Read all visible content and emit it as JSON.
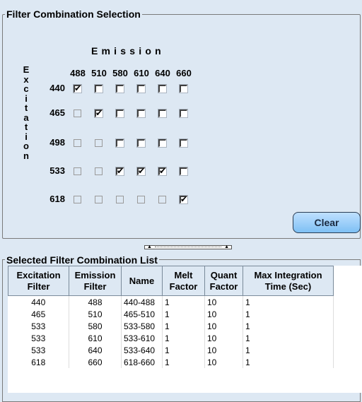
{
  "filter_selection": {
    "title": "Filter Combination Selection",
    "emission_title": "Emission",
    "excitation_title": "Excitation",
    "emission_labels": [
      "488",
      "510",
      "580",
      "610",
      "640",
      "660"
    ],
    "rows": [
      {
        "excitation": "440",
        "cells": [
          "checked",
          "unchecked",
          "unchecked",
          "unchecked",
          "unchecked",
          "unchecked"
        ]
      },
      {
        "excitation": "465",
        "cells": [
          "disabled",
          "checked",
          "unchecked",
          "unchecked",
          "unchecked",
          "unchecked"
        ]
      },
      {
        "excitation": "498",
        "cells": [
          "disabled",
          "disabled",
          "unchecked",
          "unchecked",
          "unchecked",
          "unchecked"
        ]
      },
      {
        "excitation": "533",
        "cells": [
          "disabled",
          "disabled",
          "checked",
          "checked",
          "checked",
          "unchecked"
        ]
      },
      {
        "excitation": "618",
        "cells": [
          "disabled",
          "disabled",
          "disabled",
          "disabled",
          "disabled",
          "checked"
        ]
      }
    ],
    "clear_label": "Clear"
  },
  "combination_list": {
    "title": "Selected Filter Combination List",
    "headers": {
      "excitation": "Excitation Filter",
      "emission": "Emission Filter",
      "name": "Name",
      "melt": "Melt Factor",
      "quant": "Quant Factor",
      "max_integration": "Max Integration Time (Sec)"
    },
    "rows": [
      {
        "excitation": "440",
        "emission": "488",
        "name": "440-488",
        "melt": "1",
        "quant": "10",
        "max": "1"
      },
      {
        "excitation": "465",
        "emission": "510",
        "name": "465-510",
        "melt": "1",
        "quant": "10",
        "max": "1"
      },
      {
        "excitation": "533",
        "emission": "580",
        "name": "533-580",
        "melt": "1",
        "quant": "10",
        "max": "1"
      },
      {
        "excitation": "533",
        "emission": "610",
        "name": "533-610",
        "melt": "1",
        "quant": "10",
        "max": "1"
      },
      {
        "excitation": "533",
        "emission": "640",
        "name": "533-640",
        "melt": "1",
        "quant": "10",
        "max": "1"
      },
      {
        "excitation": "618",
        "emission": "660",
        "name": "618-660",
        "melt": "1",
        "quant": "10",
        "max": "1"
      }
    ]
  },
  "colors": {
    "background": "#dde8f3",
    "button": "#7ec0f4"
  }
}
